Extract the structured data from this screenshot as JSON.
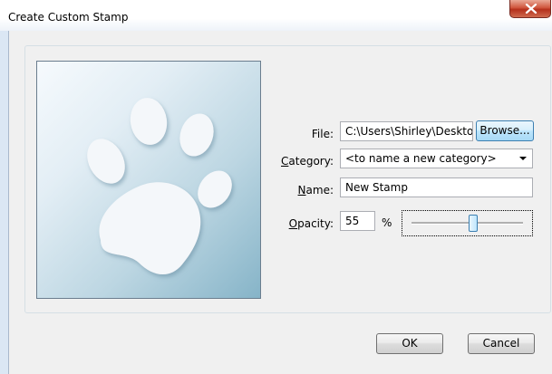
{
  "window": {
    "title": "Create Custom Stamp"
  },
  "form": {
    "file": {
      "label": "File:",
      "value": "C:\\Users\\Shirley\\Desktop",
      "browse_label": "Browse..."
    },
    "category": {
      "label_accel": "C",
      "label_rest": "ategory:",
      "value": "<to name a new category>"
    },
    "name": {
      "label_accel": "N",
      "label_rest": "ame:",
      "value": "New Stamp"
    },
    "opacity": {
      "label_accel": "O",
      "label_rest": "pacity:",
      "value": "55",
      "unit": "%",
      "slider_level": 0.55
    }
  },
  "buttons": {
    "ok": "OK",
    "cancel": "Cancel"
  },
  "preview": {
    "icon": "paw-print-icon"
  }
}
